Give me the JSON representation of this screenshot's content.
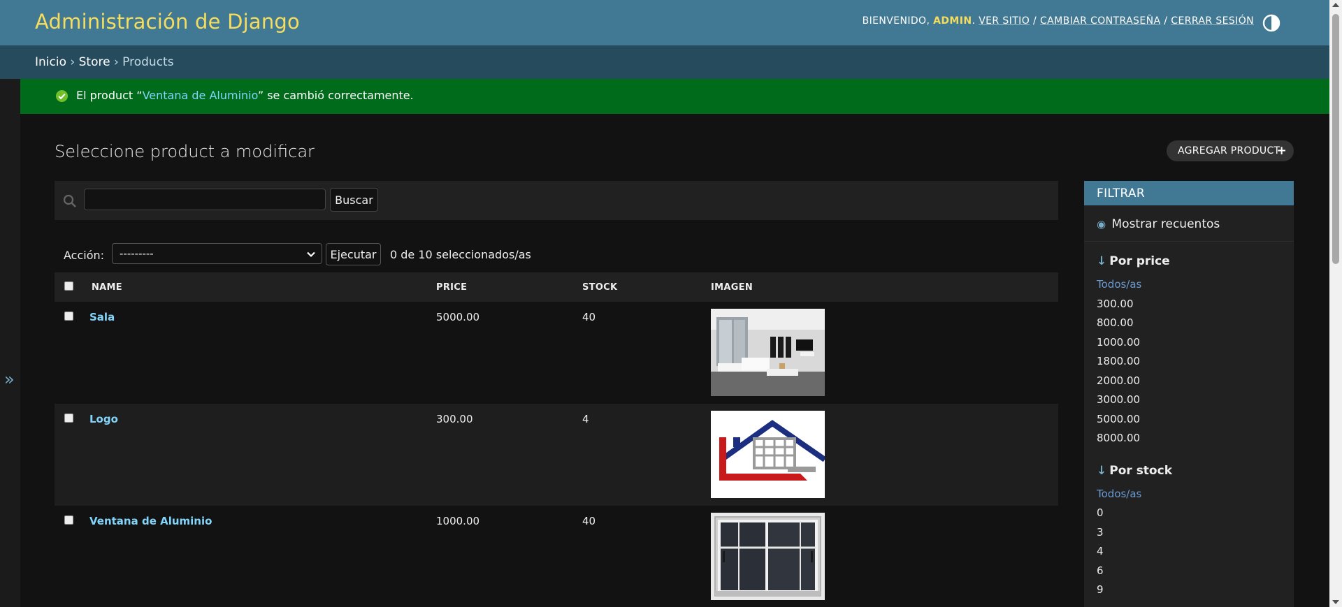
{
  "header": {
    "site_name": "Administración de Django",
    "welcome": "Bienvenido,",
    "user": "admin",
    "view_site": "Ver sitio",
    "change_password": "Cambiar contraseña",
    "logout": "Cerrar sesión",
    "separator": "/"
  },
  "breadcrumbs": {
    "home": "Inicio",
    "app": "Store",
    "model": "Products",
    "sep": "›"
  },
  "nav_toggle": {
    "glyph": "»"
  },
  "message": {
    "before": "El product “",
    "link": "Ventana de Aluminio",
    "after": "” se cambió correctamente."
  },
  "title": "Seleccione product a modificar",
  "add_button": {
    "label": "Agregar product",
    "icon": "+"
  },
  "search": {
    "value": "",
    "button": "Buscar"
  },
  "actions": {
    "label": "Acción:",
    "selected_option": "---------",
    "run": "Ejecutar",
    "counter": "0 de 10 seleccionados/as"
  },
  "table": {
    "headers": [
      "Name",
      "Price",
      "Stock",
      "Imagen"
    ],
    "rows": [
      {
        "name": "Sala",
        "price": "5000.00",
        "stock": "40",
        "image": "living-room-photo"
      },
      {
        "name": "Logo",
        "price": "300.00",
        "stock": "4",
        "image": "house-logo"
      },
      {
        "name": "Ventana de Aluminio",
        "price": "1000.00",
        "stock": "40",
        "image": "aluminum-window-photo"
      }
    ]
  },
  "filter": {
    "title": "Filtrar",
    "toggle": "Mostrar recuentos",
    "price": {
      "heading": "Por price",
      "options": [
        "Todos/as",
        "300.00",
        "800.00",
        "1000.00",
        "1800.00",
        "2000.00",
        "3000.00",
        "5000.00",
        "8000.00"
      ]
    },
    "stock": {
      "heading": "Por stock",
      "options": [
        "Todos/as",
        "0",
        "3",
        "4",
        "6",
        "9"
      ]
    }
  },
  "colors": {
    "header": "#417893",
    "breadcrumbs": "#264b5d",
    "accent_yellow": "#f5dd5d",
    "success": "#006b1b",
    "link": "#81d4fa"
  }
}
